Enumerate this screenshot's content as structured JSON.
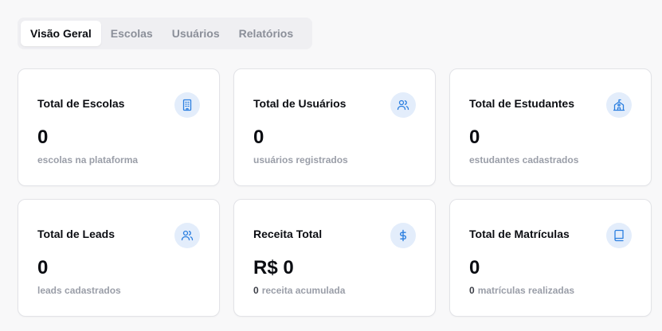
{
  "tabs": [
    {
      "label": "Visão Geral",
      "active": true
    },
    {
      "label": "Escolas",
      "active": false
    },
    {
      "label": "Usuários",
      "active": false
    },
    {
      "label": "Relatórios",
      "active": false
    }
  ],
  "cards": [
    {
      "title": "Total de Escolas",
      "value": "0",
      "subtitle": "escolas na plataforma",
      "icon": "building-icon"
    },
    {
      "title": "Total de Usuários",
      "value": "0",
      "subtitle": "usuários registrados",
      "icon": "users-icon"
    },
    {
      "title": "Total de Estudantes",
      "value": "0",
      "subtitle": "estudantes cadastrados",
      "icon": "school-icon"
    },
    {
      "title": "Total de Leads",
      "value": "0",
      "subtitle": "leads cadastrados",
      "icon": "users-icon"
    },
    {
      "title": "Receita Total",
      "value": "R$ 0",
      "sub_number": "0",
      "subtitle": "receita acumulada",
      "icon": "dollar-icon"
    },
    {
      "title": "Total de Matrículas",
      "value": "0",
      "sub_number": "0",
      "subtitle": "matrículas realizadas",
      "icon": "book-icon"
    }
  ],
  "colors": {
    "accent": "#2b7fe0",
    "icon_bg": "#e3edfb",
    "page_bg": "#f8f8f9",
    "muted_text": "#9a9ea8"
  }
}
